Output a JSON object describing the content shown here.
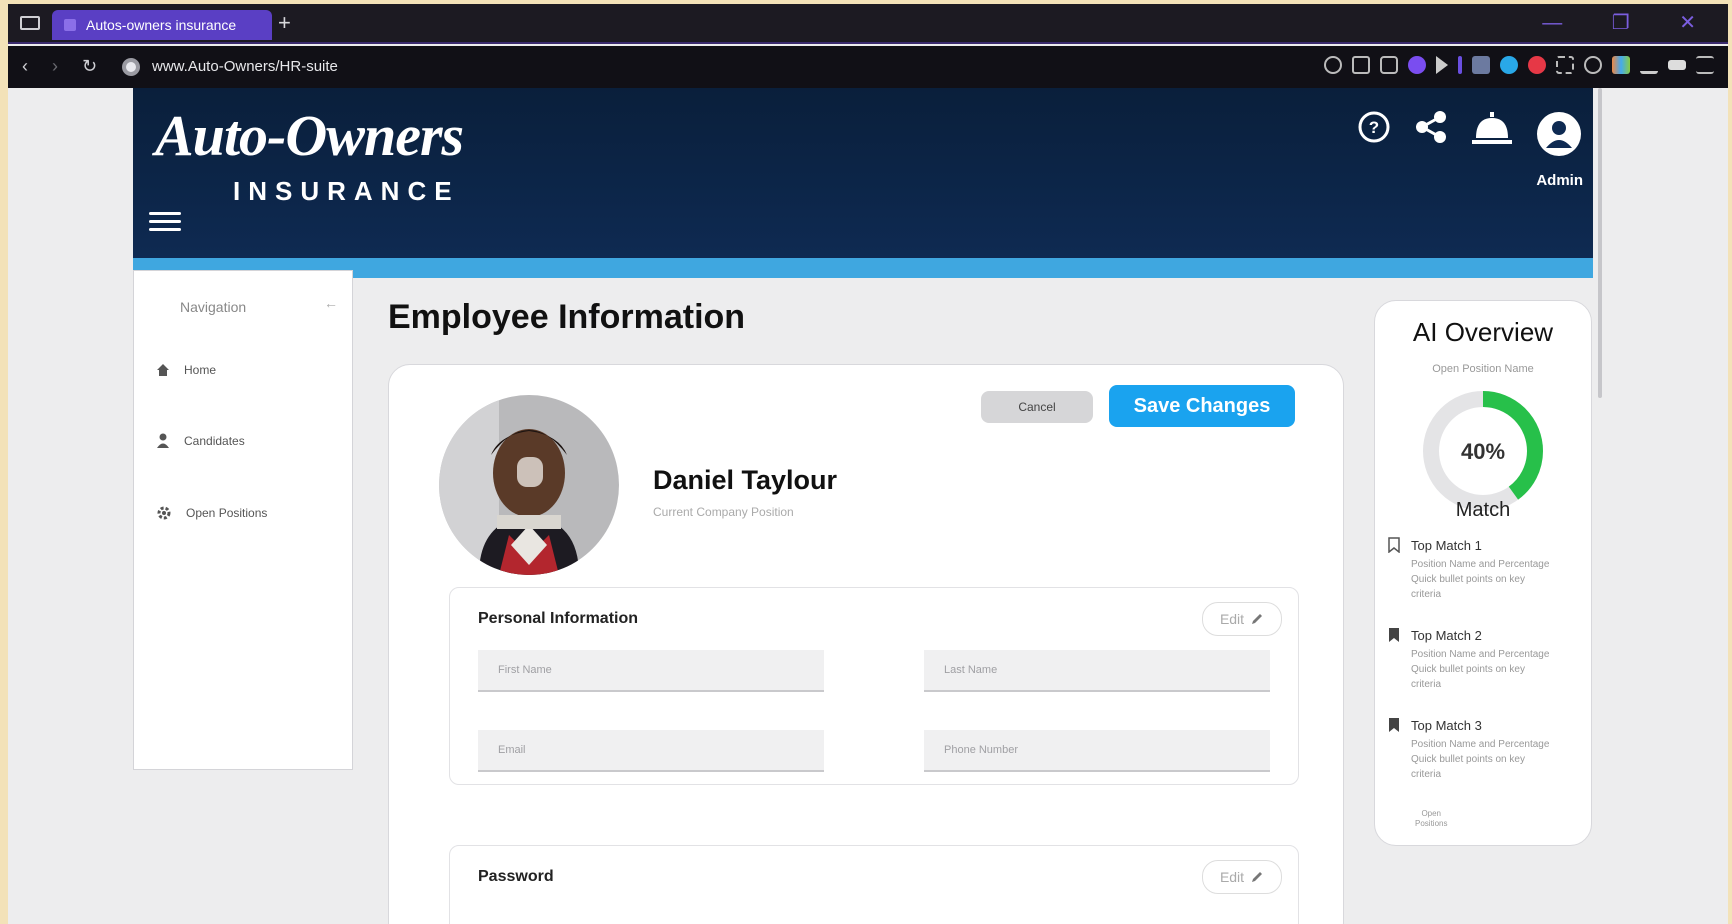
{
  "browser": {
    "tab_title": "Autos-owners insurance",
    "new_tab": "+",
    "url": "www.Auto-Owners/HR-suite",
    "window_controls": "—  ❐  ✕"
  },
  "header": {
    "logo_main": "Auto-Owners",
    "logo_sub": "INSURANCE",
    "admin_label": "Admin",
    "icons": [
      "help-icon",
      "share-icon",
      "service-bell-icon",
      "account-icon"
    ]
  },
  "sidebar": {
    "title": "Navigation",
    "collapse_icon": "←",
    "items": [
      {
        "label": "Home",
        "icon": "home-icon"
      },
      {
        "label": "Candidates",
        "icon": "person-icon"
      },
      {
        "label": "Open Positions",
        "icon": "gear-icon"
      }
    ]
  },
  "main": {
    "page_title": "Employee Information",
    "employee_name": "Daniel Taylour",
    "employee_position": "Current Company Position",
    "cancel_label": "Cancel",
    "save_label": "Save Changes",
    "personal": {
      "title": "Personal Information",
      "edit_label": "Edit",
      "first_name_placeholder": "First Name",
      "last_name_placeholder": "Last Name",
      "email_placeholder": "Email",
      "phone_placeholder": "Phone Number"
    },
    "password": {
      "title": "Password",
      "edit_label": "Edit"
    }
  },
  "ai_overview": {
    "title": "AI Overview",
    "subtitle": "Open Position Name",
    "percent_label": "40%",
    "percent_value": 0.4,
    "match_label": "Match",
    "accent_color": "#27c04a",
    "matches": [
      {
        "title": "Top Match 1",
        "line1": "Position Name and Percentage",
        "line2": "Quick bullet points on key",
        "line3": "criteria",
        "bookmark_filled": false
      },
      {
        "title": "Top Match 2",
        "line1": "Position Name and Percentage",
        "line2": "Quick bullet points on key",
        "line3": "criteria",
        "bookmark_filled": true
      },
      {
        "title": "Top Match 3",
        "line1": "Position Name and Percentage",
        "line2": "Quick bullet points on key",
        "line3": "criteria",
        "bookmark_filled": true
      }
    ],
    "open_positions_l1": "Open",
    "open_positions_l2": "Positions"
  },
  "colors": {
    "header_bg": "#0e2a52",
    "stripe": "#3fa7e0",
    "save_button": "#1aa3ef",
    "tab_active": "#5a3fc4"
  }
}
